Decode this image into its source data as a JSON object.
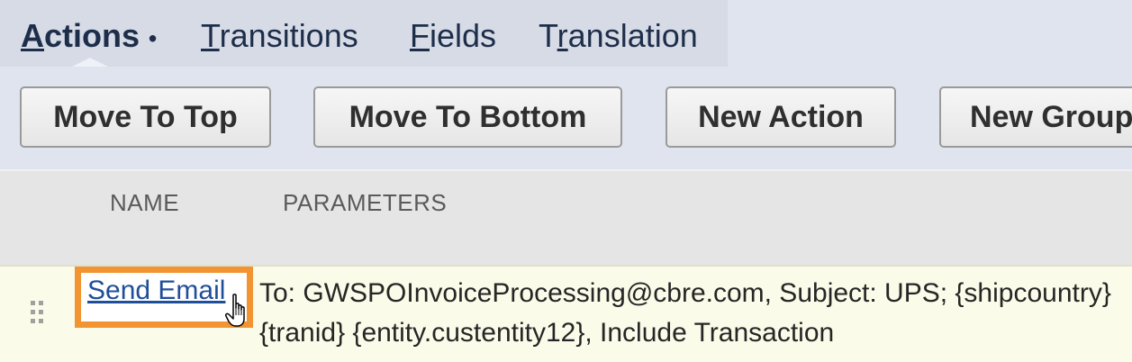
{
  "tabs": {
    "actions": {
      "accel": "A",
      "rest": "ctions",
      "marker": "•"
    },
    "transitions": {
      "accel": "T",
      "rest": "ransitions"
    },
    "fields": {
      "accel": "F",
      "rest": "ields"
    },
    "translation": {
      "pre": "T",
      "accel": "r",
      "rest": "anslation"
    }
  },
  "toolbar": {
    "move_to_top": "Move To Top",
    "move_to_bottom": "Move To Bottom",
    "new_action": "New Action",
    "new_group": "New Group"
  },
  "table": {
    "columns": [
      "NAME",
      "PARAMETERS"
    ],
    "rows": [
      {
        "name": "Send Email",
        "parameters": "To: GWSPOInvoiceProcessing@cbre.com, Subject: UPS; {shipcountry} {tranid} {entity.custentity12}, Include Transaction"
      }
    ]
  },
  "colors": {
    "highlight": "#f29431",
    "link": "#1f4f9a",
    "row_background": "#fbfbe9"
  },
  "icons": {
    "drag_handle": "drag-handle-icon",
    "cursor": "hand-pointer-icon"
  }
}
